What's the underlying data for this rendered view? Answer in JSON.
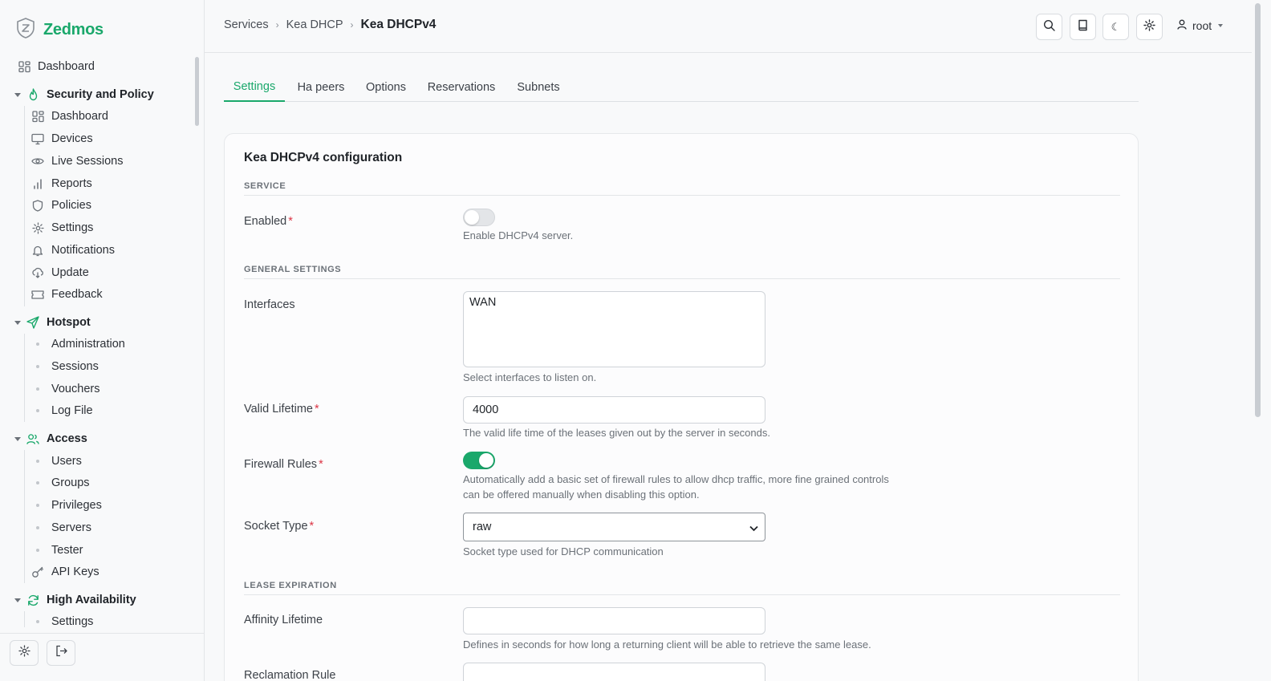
{
  "brand": {
    "name": "Zedmos",
    "accent": "#1aa86b"
  },
  "sidebar": {
    "top_item": {
      "label": "Dashboard",
      "icon": "grid-icon"
    },
    "groups": [
      {
        "label": "Security and Policy",
        "icon": "flame-icon",
        "items": [
          {
            "label": "Dashboard",
            "icon": "grid-icon"
          },
          {
            "label": "Devices",
            "icon": "monitor-icon"
          },
          {
            "label": "Live Sessions",
            "icon": "eye-icon"
          },
          {
            "label": "Reports",
            "icon": "bar-chart-icon"
          },
          {
            "label": "Policies",
            "icon": "shield-icon"
          },
          {
            "label": "Settings",
            "icon": "gear-icon"
          },
          {
            "label": "Notifications",
            "icon": "bell-icon"
          },
          {
            "label": "Update",
            "icon": "cloud-download-icon"
          },
          {
            "label": "Feedback",
            "icon": "ticket-icon"
          }
        ]
      },
      {
        "label": "Hotspot",
        "icon": "send-icon",
        "items": [
          {
            "label": "Administration"
          },
          {
            "label": "Sessions"
          },
          {
            "label": "Vouchers"
          },
          {
            "label": "Log File"
          }
        ]
      },
      {
        "label": "Access",
        "icon": "users-icon",
        "items": [
          {
            "label": "Users"
          },
          {
            "label": "Groups"
          },
          {
            "label": "Privileges"
          },
          {
            "label": "Servers"
          },
          {
            "label": "Tester"
          },
          {
            "label": "API Keys",
            "icon": "key-icon"
          }
        ]
      },
      {
        "label": "High Availability",
        "icon": "refresh-icon",
        "items": [
          {
            "label": "Settings"
          }
        ]
      }
    ]
  },
  "header": {
    "breadcrumb": [
      "Services",
      "Kea DHCP",
      "Kea DHCPv4"
    ],
    "user": "root"
  },
  "tabs": [
    {
      "label": "Settings",
      "active": true
    },
    {
      "label": "Ha peers"
    },
    {
      "label": "Options"
    },
    {
      "label": "Reservations"
    },
    {
      "label": "Subnets"
    }
  ],
  "form": {
    "title": "Kea DHCPv4 configuration",
    "sections": {
      "service": "SERVICE",
      "general": "GENERAL SETTINGS",
      "lease": "LEASE EXPIRATION"
    },
    "enabled": {
      "label": "Enabled",
      "required": "*",
      "value": false,
      "help": "Enable DHCPv4 server."
    },
    "interfaces": {
      "label": "Interfaces",
      "value": "WAN",
      "help": "Select interfaces to listen on."
    },
    "valid_lifetime": {
      "label": "Valid Lifetime",
      "required": "*",
      "value": "4000",
      "help": "The valid life time of the leases given out by the server in seconds."
    },
    "firewall_rules": {
      "label": "Firewall Rules",
      "required": "*",
      "value": true,
      "help_line1": "Automatically add a basic set of firewall rules to allow dhcp traffic, more fine grained controls",
      "help_line2": "can be offered manually when disabling this option."
    },
    "socket_type": {
      "label": "Socket Type",
      "required": "*",
      "value": "raw",
      "help": "Socket type used for DHCP communication"
    },
    "affinity_lifetime": {
      "label": "Affinity Lifetime",
      "value": "",
      "help": "Defines in seconds for how long a returning client will be able to retrieve the same lease."
    },
    "reclamation_partial": {
      "label": "Reclamation Rule"
    }
  }
}
